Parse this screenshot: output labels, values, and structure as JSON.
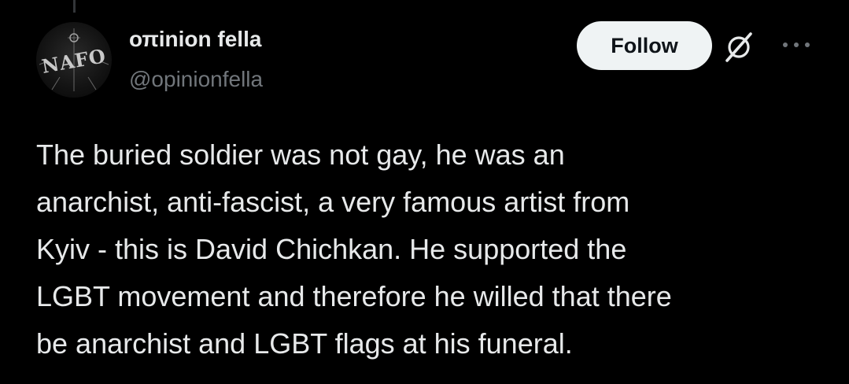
{
  "tweet": {
    "author": {
      "display_name": "οπinion fella",
      "handle": "@opinionfella",
      "avatar_text": "NAFO",
      "avatar_icon": "nafo-logo"
    },
    "follow_label": "Follow",
    "grok_icon": "grok-icon",
    "more_icon": "more-options-icon",
    "text": "The buried soldier was not gay, he was an\nanarchist, anti-fascist, a very famous artist from\nKyiv - this is David Chichkan. He supported the\nLGBT movement and therefore he willed that there\nbe anarchist and LGBT flags at his funeral."
  },
  "colors": {
    "background": "#000000",
    "primary_text": "#e7e9ea",
    "secondary_text": "#71767b",
    "follow_bg": "#eff3f4",
    "follow_text": "#0f1419"
  }
}
